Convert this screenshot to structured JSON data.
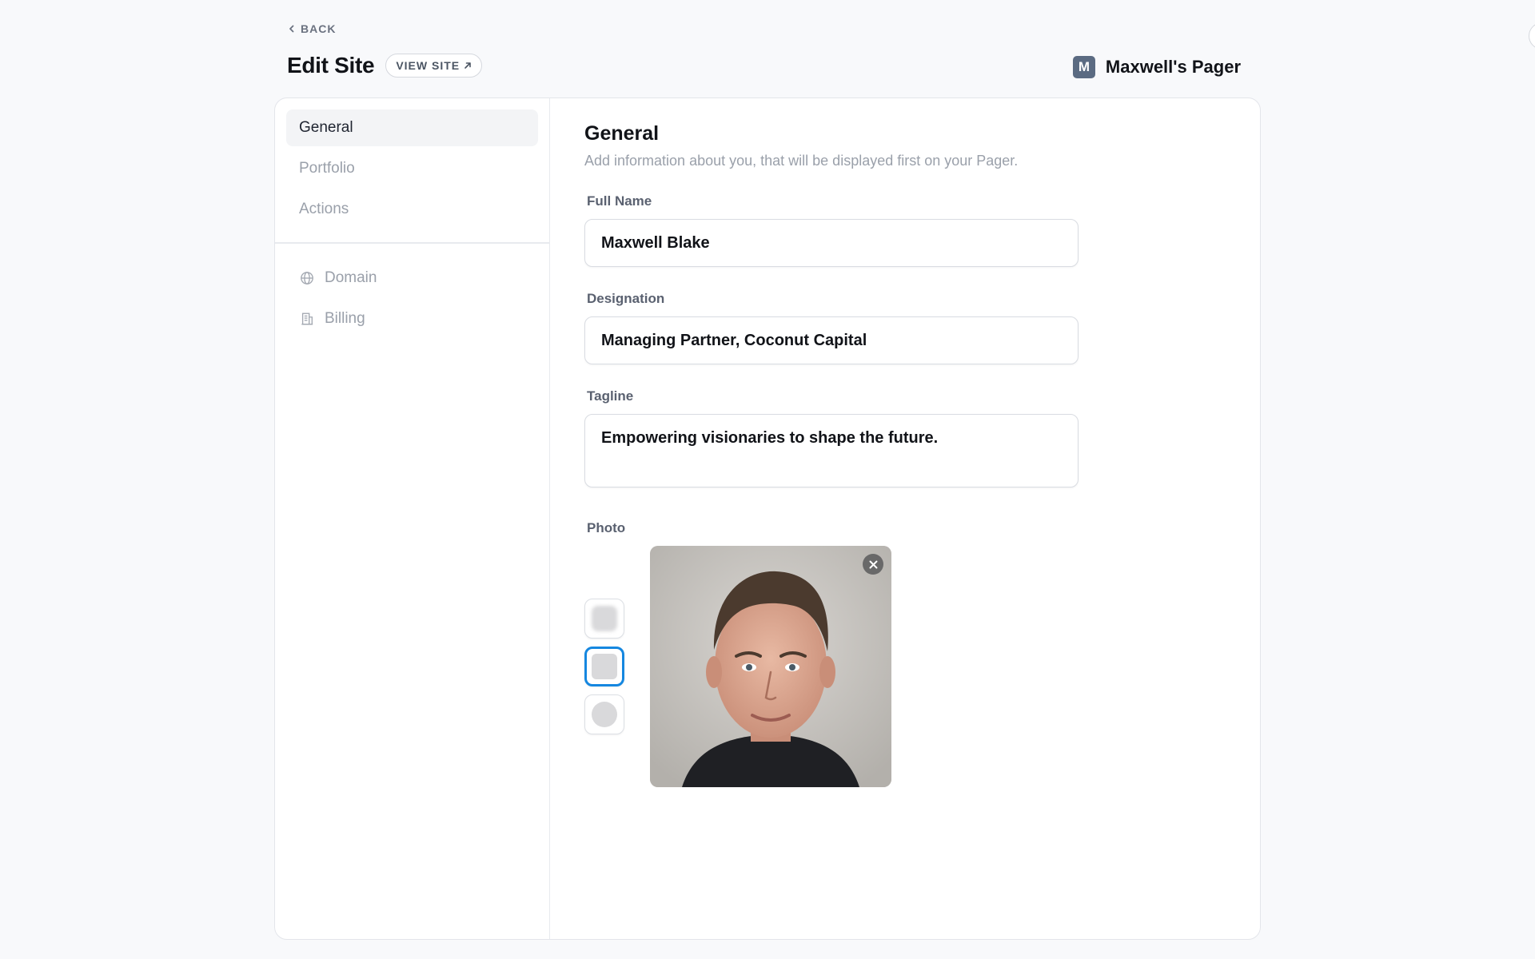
{
  "header": {
    "back_label": "BACK",
    "title": "Edit Site",
    "view_site_label": "VIEW SITE",
    "site_initial": "M",
    "site_name": "Maxwell's Pager"
  },
  "sidebar": {
    "primary": [
      {
        "label": "General",
        "active": true
      },
      {
        "label": "Portfolio",
        "active": false
      },
      {
        "label": "Actions",
        "active": false
      }
    ],
    "secondary": [
      {
        "label": "Domain",
        "icon": "globe-icon"
      },
      {
        "label": "Billing",
        "icon": "building-icon"
      }
    ]
  },
  "main": {
    "title": "General",
    "description": "Add information about you, that will be displayed first on your Pager.",
    "full_name": {
      "label": "Full Name",
      "value": "Maxwell Blake"
    },
    "designation": {
      "label": "Designation",
      "value": "Managing Partner, Coconut Capital"
    },
    "tagline": {
      "label": "Tagline",
      "value": "Empowering visionaries to shape the future."
    },
    "photo": {
      "label": "Photo",
      "shape_options": [
        "blur",
        "square",
        "circle"
      ],
      "selected_shape": "square"
    }
  },
  "colors": {
    "accent": "#1587e0",
    "avatar_bg": "#5b6b82",
    "muted_text": "#9aa0aa"
  }
}
